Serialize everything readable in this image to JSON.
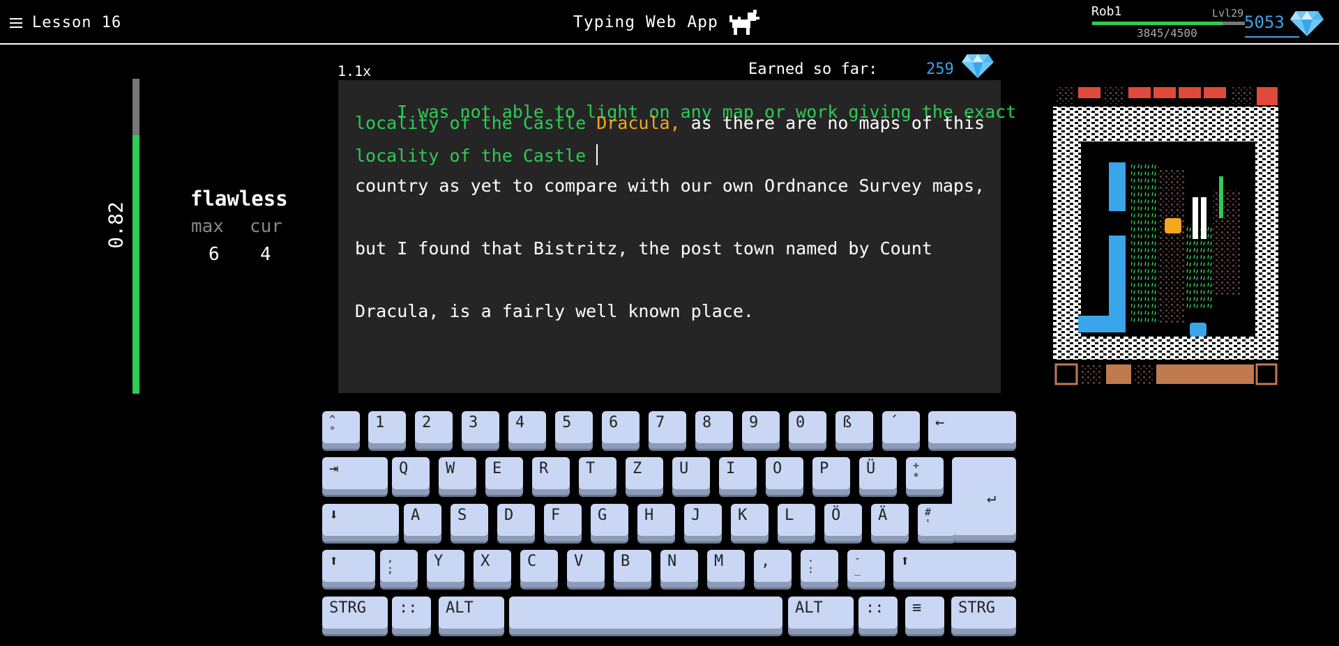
{
  "header": {
    "lesson": "Lesson 16",
    "app_title": "Typing Web App",
    "icons": {
      "menu": "hamburger-menu-icon",
      "mascot": "dog-mascot-icon",
      "gem": "diamond-gem-icon"
    }
  },
  "user": {
    "name": "Rob1",
    "level": "Lvl29",
    "xp_text": "3845/4500",
    "xp_fraction": 0.854,
    "gems": "5053"
  },
  "stats": {
    "accuracy": "0.82",
    "accuracy_fraction": 0.82,
    "streak_label": "flawless",
    "max_label": "max",
    "cur_label": "cur",
    "max_value": "6",
    "cur_value": "4"
  },
  "typing": {
    "speed": "1.1x",
    "earned_label": "Earned so far:",
    "earned_value": "259",
    "line1": "I was not able to light on any map or work giving the exact",
    "line2_typed": "locality of the Castle ",
    "line2_error": "Dracula,",
    "line2_rest": " as there are no maps of this",
    "line3_typed": "locality of the Castle ",
    "line4": "country as yet to compare with our own Ordnance Survey maps,",
    "line5": "but I found that Bistritz, the post town named by Count",
    "line6": "Dracula, is a fairly well known place."
  },
  "colors": {
    "typed": "#2ecc55",
    "error": "#f5a623",
    "gem": "#3aa5e8",
    "key_face": "#c9d7f4",
    "text_bg": "#252525"
  },
  "keyboard": {
    "row1": [
      "^\n°",
      "1",
      "2",
      "3",
      "4",
      "5",
      "6",
      "7",
      "8",
      "9",
      "0",
      "ß",
      "´",
      "←"
    ],
    "row2": [
      "⇥",
      "Q",
      "W",
      "E",
      "R",
      "T",
      "Z",
      "U",
      "I",
      "O",
      "P",
      "Ü",
      "+\n*",
      "↵"
    ],
    "row3": [
      "⬇",
      "A",
      "S",
      "D",
      "F",
      "G",
      "H",
      "J",
      "K",
      "L",
      "Ö",
      "Ä",
      "#\n'"
    ],
    "row4": [
      "⬆",
      ",\n;",
      "Y",
      "X",
      "C",
      "V",
      "B",
      "N",
      "M",
      ",",
      ".\n:",
      "-\n_",
      "⬆"
    ],
    "row5": [
      "STRG",
      "::",
      "ALT",
      "",
      "ALT",
      "::",
      "≡",
      "STRG"
    ]
  }
}
